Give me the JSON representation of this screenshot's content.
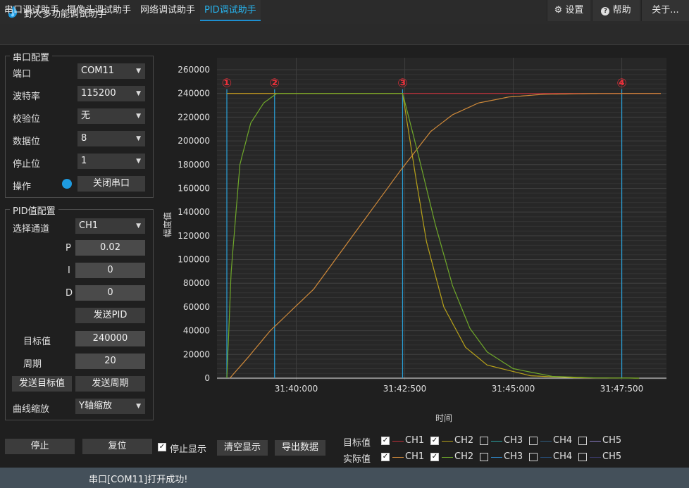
{
  "window": {
    "title": "野火多功能调试助手",
    "pin_icon": "pin-icon",
    "minimize_icon": "minimize-icon",
    "maximize_icon": "maximize-icon",
    "close_icon": "close-icon"
  },
  "tabs": [
    {
      "label": "串口调试助手",
      "active": false
    },
    {
      "label": "摄像头调试助手",
      "active": false
    },
    {
      "label": "网络调试助手",
      "active": false
    },
    {
      "label": "PID调试助手",
      "active": true
    }
  ],
  "toolbar": {
    "settings_label": "设置",
    "help_label": "帮助",
    "about_label": "关于..."
  },
  "serial": {
    "title": "串口配置",
    "port_label": "端口",
    "port_value": "COM11",
    "baud_label": "波特率",
    "baud_value": "115200",
    "parity_label": "校验位",
    "parity_value": "无",
    "databits_label": "数据位",
    "databits_value": "8",
    "stopbits_label": "停止位",
    "stopbits_value": "1",
    "op_label": "操作",
    "close_button": "关闭串口",
    "indicator_color": "#1e9be0"
  },
  "pid": {
    "title": "PID值配置",
    "channel_label": "选择通道",
    "channel_value": "CH1",
    "p_label": "P",
    "p_value": "0.02",
    "i_label": "I",
    "i_value": "0",
    "d_label": "D",
    "d_value": "0",
    "send_pid": "发送PID",
    "target_label": "目标值",
    "target_value": "240000",
    "period_label": "周期",
    "period_value": "20",
    "send_target": "发送目标值",
    "send_period": "发送周期",
    "zoom_label": "曲线缩放",
    "zoom_value": "Y轴缩放"
  },
  "controls": {
    "stop": "停止",
    "reset": "复位",
    "stop_display_label": "停止显示",
    "stop_display_checked": true,
    "clear": "清空显示",
    "export": "导出数据"
  },
  "legend": {
    "target_label": "目标值",
    "actual_label": "实际值",
    "target": [
      {
        "name": "CH1",
        "checked": true,
        "color": "#c0303a"
      },
      {
        "name": "CH2",
        "checked": true,
        "color": "#b8a21a"
      },
      {
        "name": "CH3",
        "checked": false,
        "color": "#2aa6a6"
      },
      {
        "name": "CH4",
        "checked": false,
        "color": "#2f5f82"
      },
      {
        "name": "CH5",
        "checked": false,
        "color": "#8e7fc9"
      }
    ],
    "actual": [
      {
        "name": "CH1",
        "checked": true,
        "color": "#d08a3a"
      },
      {
        "name": "CH2",
        "checked": true,
        "color": "#6fa82a"
      },
      {
        "name": "CH3",
        "checked": false,
        "color": "#2f86c8"
      },
      {
        "name": "CH4",
        "checked": false,
        "color": "#264e7a"
      },
      {
        "name": "CH5",
        "checked": false,
        "color": "#3a3a6a"
      }
    ]
  },
  "status": {
    "text": "串口[COM11]打开成功!"
  },
  "chart_data": {
    "type": "line",
    "xlabel": "时间",
    "ylabel": "幅度值",
    "ylim": [
      0,
      260000
    ],
    "yticks": [
      0,
      20000,
      40000,
      60000,
      80000,
      100000,
      120000,
      140000,
      160000,
      180000,
      200000,
      220000,
      240000,
      260000
    ],
    "xticks": [
      "31:40:000",
      "31:42:500",
      "31:45:000",
      "31:47:500"
    ],
    "xlim_s": [
      0,
      10
    ],
    "xtick_s": [
      1.6,
      4.1,
      6.6,
      9.1
    ],
    "markers": [
      {
        "label": "①",
        "x": 0
      },
      {
        "label": "②",
        "x": 1.1
      },
      {
        "label": "③",
        "x": 4.05
      },
      {
        "label": "④",
        "x": 9.1
      }
    ],
    "series": [
      {
        "name": "目标值 CH1",
        "color": "#c0303a",
        "x": [
          0,
          10
        ],
        "y": [
          240000,
          240000
        ]
      },
      {
        "name": "目标值 CH2",
        "color": "#b8a21a",
        "x": [
          0,
          4.05,
          4.35,
          4.6,
          5.0,
          5.5,
          6.0,
          7.0,
          8.0,
          9.5
        ],
        "y": [
          240000,
          240000,
          170000,
          115000,
          60000,
          26000,
          11000,
          2000,
          300,
          0
        ]
      },
      {
        "name": "实际值 CH1",
        "color": "#d08a3a",
        "x": [
          0.07,
          0.5,
          1.0,
          2.0,
          3.0,
          4.0,
          4.7,
          5.2,
          5.8,
          6.5,
          7.3,
          8.5,
          9.5,
          10
        ],
        "y": [
          0,
          18000,
          40000,
          75000,
          125000,
          175000,
          208000,
          222000,
          232000,
          237000,
          239300,
          239900,
          240000,
          240000
        ]
      },
      {
        "name": "实际值 CH2",
        "color": "#6fa82a",
        "x": [
          0,
          0.1,
          0.3,
          0.55,
          0.85,
          1.15,
          4.05,
          4.4,
          4.8,
          5.2,
          5.6,
          6.0,
          6.6,
          7.5,
          8.5,
          9.5
        ],
        "y": [
          0,
          90000,
          180000,
          215000,
          232000,
          240000,
          240000,
          190000,
          130000,
          78000,
          42000,
          22000,
          8000,
          1500,
          200,
          0
        ]
      }
    ]
  }
}
